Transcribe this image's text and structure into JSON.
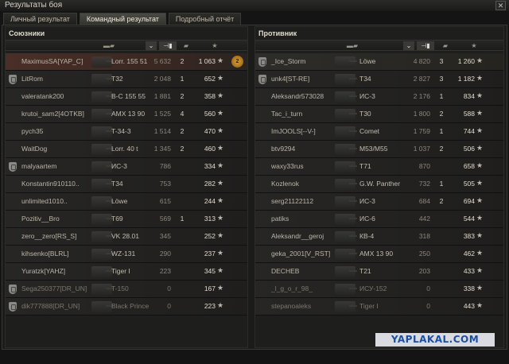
{
  "window": {
    "title": "Результаты боя",
    "close_glyph": "✕"
  },
  "tabs": [
    {
      "label": "Личный результат"
    },
    {
      "label": "Командный результат",
      "active": true
    },
    {
      "label": "Подробный отчёт"
    }
  ],
  "allies": {
    "title": "Союзники",
    "rows": [
      {
        "player": "MaximusSA[YAP_C]",
        "tank": "Lorr. 155 51",
        "damage": "5 632",
        "frags": "2",
        "xp": "1 063",
        "platoon": false,
        "me": true,
        "medal": "2"
      },
      {
        "player": "LitRom",
        "tank": "T32",
        "damage": "2 048",
        "frags": "1",
        "xp": "652",
        "platoon": true
      },
      {
        "player": "valeratank200",
        "tank": "B-C 155 55",
        "damage": "1 881",
        "frags": "2",
        "xp": "358",
        "platoon": false
      },
      {
        "player": "krutoi_sam2[4OTKB]",
        "tank": "AMX 13 90",
        "damage": "1 525",
        "frags": "4",
        "xp": "560",
        "platoon": false
      },
      {
        "player": "pych35",
        "tank": "T-34-3",
        "damage": "1 514",
        "frags": "2",
        "xp": "470",
        "platoon": false
      },
      {
        "player": "WaitDog",
        "tank": "Lorr. 40 t",
        "damage": "1 345",
        "frags": "2",
        "xp": "460",
        "platoon": false
      },
      {
        "player": "malyaartem",
        "tank": "ИС-3",
        "damage": "786",
        "frags": "",
        "xp": "334",
        "platoon": true
      },
      {
        "player": "Konstantin910110..",
        "tank": "T34",
        "damage": "753",
        "frags": "",
        "xp": "282",
        "platoon": false
      },
      {
        "player": "unlimited1010..",
        "tank": "Löwe",
        "damage": "615",
        "frags": "",
        "xp": "244",
        "platoon": false
      },
      {
        "player": "Pozitiv__Bro",
        "tank": "T69",
        "damage": "569",
        "frags": "1",
        "xp": "313",
        "platoon": false
      },
      {
        "player": "zero__zero[RS_S]",
        "tank": "VK 28.01",
        "damage": "345",
        "frags": "",
        "xp": "252",
        "platoon": false
      },
      {
        "player": "kihsenko[BLRL]",
        "tank": "WZ-131",
        "damage": "290",
        "frags": "",
        "xp": "237",
        "platoon": false
      },
      {
        "player": "Yuratzk[YAHZ]",
        "tank": "Tiger I",
        "damage": "223",
        "frags": "",
        "xp": "345",
        "platoon": false
      },
      {
        "player": "Sega250377[DR_UN]",
        "tank": "T-150",
        "damage": "0",
        "frags": "",
        "xp": "167",
        "platoon": true
      },
      {
        "player": "dik777888[DR_UN]",
        "tank": "Black Prince",
        "damage": "0",
        "frags": "",
        "xp": "223",
        "platoon": true
      }
    ]
  },
  "enemies": {
    "title": "Противник",
    "rows": [
      {
        "player": "_Ice_Storm",
        "tank": "Löwe",
        "damage": "4 820",
        "frags": "3",
        "xp": "1 260",
        "platoon": true,
        "top": true
      },
      {
        "player": "unk4[ST-RE]",
        "tank": "T34",
        "damage": "2 827",
        "frags": "3",
        "xp": "1 182",
        "platoon": true
      },
      {
        "player": "Aleksandr573028",
        "tank": "ИС-3",
        "damage": "2 176",
        "frags": "1",
        "xp": "834",
        "platoon": false
      },
      {
        "player": "Tac_i_turn",
        "tank": "T30",
        "damage": "1 800",
        "frags": "2",
        "xp": "588",
        "platoon": false
      },
      {
        "player": "ImJOOLS[--V-]",
        "tank": "Comet",
        "damage": "1 759",
        "frags": "1",
        "xp": "744",
        "platoon": false
      },
      {
        "player": "btv9294",
        "tank": "M53/M55",
        "damage": "1 037",
        "frags": "2",
        "xp": "506",
        "platoon": false
      },
      {
        "player": "waxy33rus",
        "tank": "T71",
        "damage": "870",
        "frags": "",
        "xp": "658",
        "platoon": false
      },
      {
        "player": "Kozlenok",
        "tank": "G.W. Panther",
        "damage": "732",
        "frags": "1",
        "xp": "505",
        "platoon": false
      },
      {
        "player": "serg21122112",
        "tank": "ИС-3",
        "damage": "684",
        "frags": "2",
        "xp": "694",
        "platoon": false
      },
      {
        "player": "patiks",
        "tank": "ИС-6",
        "damage": "442",
        "frags": "",
        "xp": "544",
        "platoon": false
      },
      {
        "player": "Aleksandr__geroj",
        "tank": "КВ-4",
        "damage": "318",
        "frags": "",
        "xp": "383",
        "platoon": false
      },
      {
        "player": "geka_2001[V_RST]",
        "tank": "AMX 13 90",
        "damage": "250",
        "frags": "",
        "xp": "462",
        "platoon": false
      },
      {
        "player": "DECHEB",
        "tank": "T21",
        "damage": "203",
        "frags": "",
        "xp": "433",
        "platoon": false
      },
      {
        "player": "_l_g_o_r_98_",
        "tank": "ИСУ-152",
        "damage": "0",
        "frags": "",
        "xp": "338",
        "platoon": false
      },
      {
        "player": "stepanoaleks",
        "tank": "Tiger I",
        "damage": "0",
        "frags": "",
        "xp": "443",
        "platoon": false
      }
    ]
  },
  "icons": {
    "star": "★",
    "sort": "⌄",
    "platoon": "platoon-badge-icon",
    "tank_col": "tank-icon",
    "damage_col": "damage-icon",
    "frags_col": "frags-icon",
    "xp_col": "xp-star-icon"
  },
  "watermark": "YAPLAKAL.COM",
  "colors": {
    "self_row": "#4a2f27",
    "watermark_text": "#1d4fa0",
    "medal": "#e0a030"
  }
}
